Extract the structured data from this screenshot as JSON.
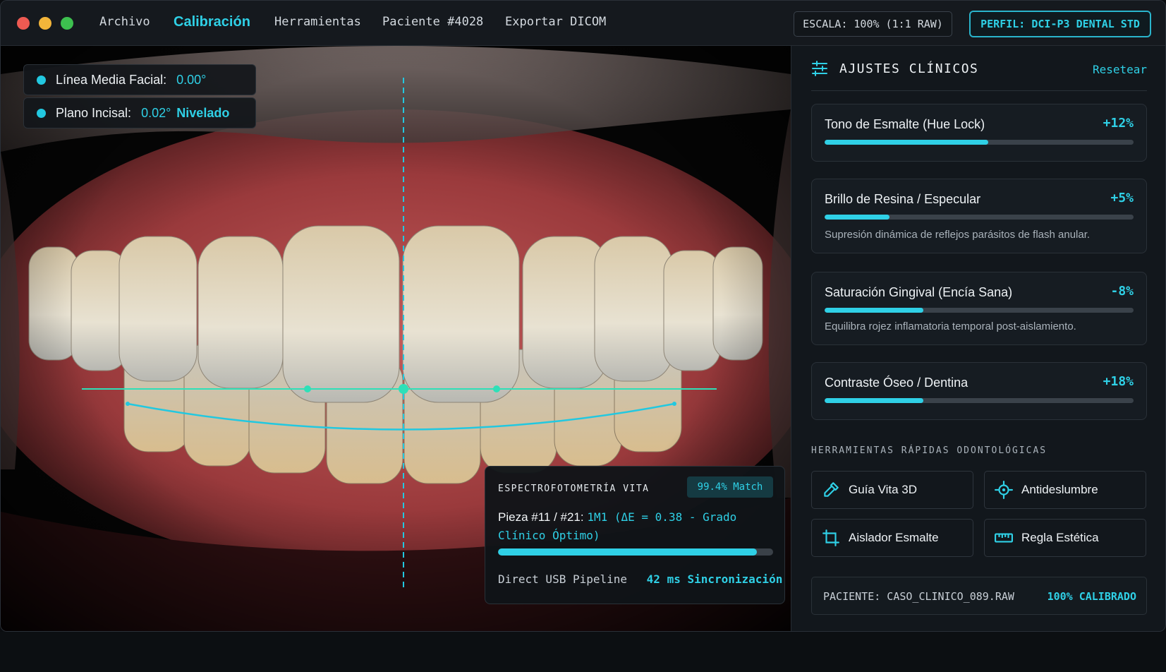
{
  "menu": {
    "items": [
      {
        "label": "Archivo",
        "active": false
      },
      {
        "label": "Calibración",
        "active": true
      },
      {
        "label": "Herramientas",
        "active": false
      },
      {
        "label": "Paciente #4028",
        "active": false
      },
      {
        "label": "Exportar DICOM",
        "active": false
      }
    ],
    "scale": "ESCALA: 100% (1:1 RAW)",
    "profile": "PERFIL: DCI-P3 DENTAL STD"
  },
  "overlays": {
    "midline": {
      "label": "Línea Media Facial:",
      "value": "0.00°"
    },
    "incisal": {
      "label": "Plano Incisal:",
      "value": "0.02°",
      "status": "Nivelado"
    }
  },
  "spectro": {
    "title": "ESPECTROFOTOMETRÍA VITA",
    "match": "99.4% Match",
    "piece_label": "Pieza #11 / #21:",
    "result_line1": "1M1 (ΔE = 0.38 - Grado",
    "result_line2": "Clínico Óptimo)",
    "progress": 0.94,
    "pipeline_label": "Direct USB Pipeline",
    "pipeline_value": "42 ms Sincronización"
  },
  "panel": {
    "title": "AJUSTES CLÍNICOS",
    "reset": "Resetear",
    "adjustments": [
      {
        "label": "Tono de Esmalte (Hue Lock)",
        "value": "+12%",
        "level": 0.53,
        "desc": ""
      },
      {
        "label": "Brillo de Resina / Especular",
        "value": "+5%",
        "level": 0.21,
        "desc": "Supresión dinámica de reflejos parásitos de flash anular."
      },
      {
        "label": "Saturación Gingival (Encía Sana)",
        "value": "-8%",
        "level": 0.32,
        "desc": "Equilibra rojez inflamatoria temporal post-aislamiento."
      },
      {
        "label": "Contraste Óseo / Dentina",
        "value": "+18%",
        "level": 0.32,
        "desc": ""
      }
    ],
    "tools_title": "HERRAMIENTAS RÁPIDAS ODONTOLÓGICAS",
    "tools": [
      {
        "label": "Guía Vita 3D",
        "icon": "eyedropper-icon"
      },
      {
        "label": "Antideslumbre",
        "icon": "crosshair-icon"
      },
      {
        "label": "Aislador Esmalte",
        "icon": "crop-icon"
      },
      {
        "label": "Regla Estética",
        "icon": "ruler-icon"
      }
    ],
    "patient": "PACIENTE: CASO_CLINICO_089.RAW",
    "calibration": "100% CALIBRADO"
  },
  "colors": {
    "accent": "#2fd0e6",
    "background": "#0e1216",
    "panel": "#12171c"
  }
}
